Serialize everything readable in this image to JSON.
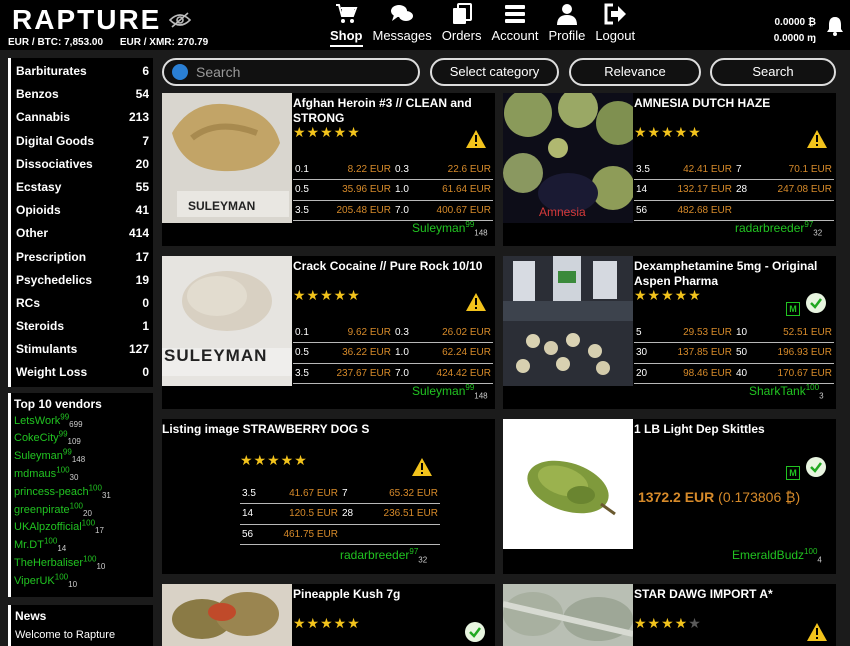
{
  "header": {
    "logo": "RAPTURE",
    "rate_btc": "EUR / BTC: 7,853.00",
    "rate_xmr": "EUR / XMR: 270.79",
    "balance_btc": "0.0000 ₿",
    "balance_xmr": "0.0000 ɱ",
    "nav": [
      {
        "label": "Shop",
        "icon": "cart-icon"
      },
      {
        "label": "Messages",
        "icon": "chat-icon"
      },
      {
        "label": "Orders",
        "icon": "orders-icon"
      },
      {
        "label": "Account",
        "icon": "menu-icon"
      },
      {
        "label": "Profile",
        "icon": "user-icon"
      },
      {
        "label": "Logout",
        "icon": "logout-icon"
      }
    ]
  },
  "categories": [
    {
      "name": "Barbiturates",
      "count": "6"
    },
    {
      "name": "Benzos",
      "count": "54"
    },
    {
      "name": "Cannabis",
      "count": "213"
    },
    {
      "name": "Digital Goods",
      "count": "7"
    },
    {
      "name": "Dissociatives",
      "count": "20"
    },
    {
      "name": "Ecstasy",
      "count": "55"
    },
    {
      "name": "Opioids",
      "count": "41"
    },
    {
      "name": "Other",
      "count": "414"
    },
    {
      "name": "Prescription",
      "count": "17"
    },
    {
      "name": "Psychedelics",
      "count": "19"
    },
    {
      "name": "RCs",
      "count": "0"
    },
    {
      "name": "Steroids",
      "count": "1"
    },
    {
      "name": "Stimulants",
      "count": "127"
    },
    {
      "name": "Weight Loss",
      "count": "0"
    }
  ],
  "top_vendors": {
    "title": "Top 10 vendors",
    "items": [
      {
        "name": "LetsWork",
        "score": "99",
        "count": "699"
      },
      {
        "name": "CokeCity",
        "score": "99",
        "count": "109"
      },
      {
        "name": "Suleyman",
        "score": "99",
        "count": "148"
      },
      {
        "name": "mdmaus",
        "score": "100",
        "count": "30"
      },
      {
        "name": "princess-peach",
        "score": "100",
        "count": "31"
      },
      {
        "name": "greenpirate",
        "score": "100",
        "count": "20"
      },
      {
        "name": "UKAlpzofficial",
        "score": "100",
        "count": "17"
      },
      {
        "name": "Mr.DT",
        "score": "100",
        "count": "14"
      },
      {
        "name": "TheHerbaliser",
        "score": "100",
        "count": "10"
      },
      {
        "name": "ViperUK",
        "score": "100",
        "count": "10"
      }
    ]
  },
  "news": {
    "title": "News",
    "text": "Welcome to Rapture"
  },
  "search": {
    "placeholder": "Search",
    "category": "Select category",
    "sort": "Relevance",
    "button": "Search"
  },
  "listings": [
    {
      "title": "Afghan Heroin #3 // CLEAN and STRONG",
      "image_text": "SULEYMAN",
      "rating": 5,
      "prices": [
        [
          "0.1",
          "8.22 EUR",
          "0.3",
          "22.6 EUR"
        ],
        [
          "0.5",
          "35.96 EUR",
          "1.0",
          "61.64 EUR"
        ],
        [
          "3.5",
          "205.48 EUR",
          "7.0",
          "400.67 EUR"
        ]
      ],
      "vendor": "Suleyman",
      "vendor_score": "99",
      "vendor_count": "148"
    },
    {
      "title": "AMNESIA DUTCH HAZE",
      "image_text": "Amnesia",
      "rating": 5,
      "prices": [
        [
          "3.5",
          "42.41 EUR",
          "7",
          "70.1 EUR"
        ],
        [
          "14",
          "132.17 EUR",
          "28",
          "247.08 EUR"
        ],
        [
          "56",
          "482.68 EUR",
          "",
          ""
        ]
      ],
      "vendor": "radarbreeder",
      "vendor_score": "97",
      "vendor_count": "32"
    },
    {
      "title": "Crack Cocaine // Pure Rock 10/10",
      "image_text": "SULEYMAN",
      "rating": 5,
      "prices": [
        [
          "0.1",
          "9.62 EUR",
          "0.3",
          "26.02 EUR"
        ],
        [
          "0.5",
          "36.22 EUR",
          "1.0",
          "62.24 EUR"
        ],
        [
          "3.5",
          "237.67 EUR",
          "7.0",
          "424.42 EUR"
        ]
      ],
      "vendor": "Suleyman",
      "vendor_score": "99",
      "vendor_count": "148"
    },
    {
      "title": "Dexamphetamine 5mg - Original Aspen Pharma",
      "image_text": "",
      "badge": "M",
      "rating": 5,
      "prices": [
        [
          "5",
          "29.53 EUR",
          "10",
          "52.51 EUR"
        ],
        [
          "30",
          "137.85 EUR",
          "50",
          "196.93 EUR"
        ],
        [
          "20",
          "98.46 EUR",
          "40",
          "170.67 EUR"
        ]
      ],
      "vendor": "SharkTank",
      "vendor_score": "100",
      "vendor_count": "3"
    },
    {
      "title": "Listing image STRAWBERRY DOG S",
      "rating": 5,
      "prices": [
        [
          "3.5",
          "41.67 EUR",
          "7",
          "65.32 EUR"
        ],
        [
          "14",
          "120.5 EUR",
          "28",
          "236.51 EUR"
        ],
        [
          "56",
          "461.75 EUR",
          "",
          ""
        ]
      ],
      "vendor": "radarbreeder",
      "vendor_score": "97",
      "vendor_count": "32"
    },
    {
      "title": "1 LB Light Dep Skittles",
      "badge": "M",
      "price": "1372.2 EUR",
      "price_btc": "(0.173806 ₿)",
      "vendor": "EmeraldBudz",
      "vendor_score": "100",
      "vendor_count": "4"
    },
    {
      "title": "Pineapple Kush 7g",
      "rating": 5
    },
    {
      "title": "STAR DAWG IMPORT A*",
      "rating": 4
    }
  ]
}
